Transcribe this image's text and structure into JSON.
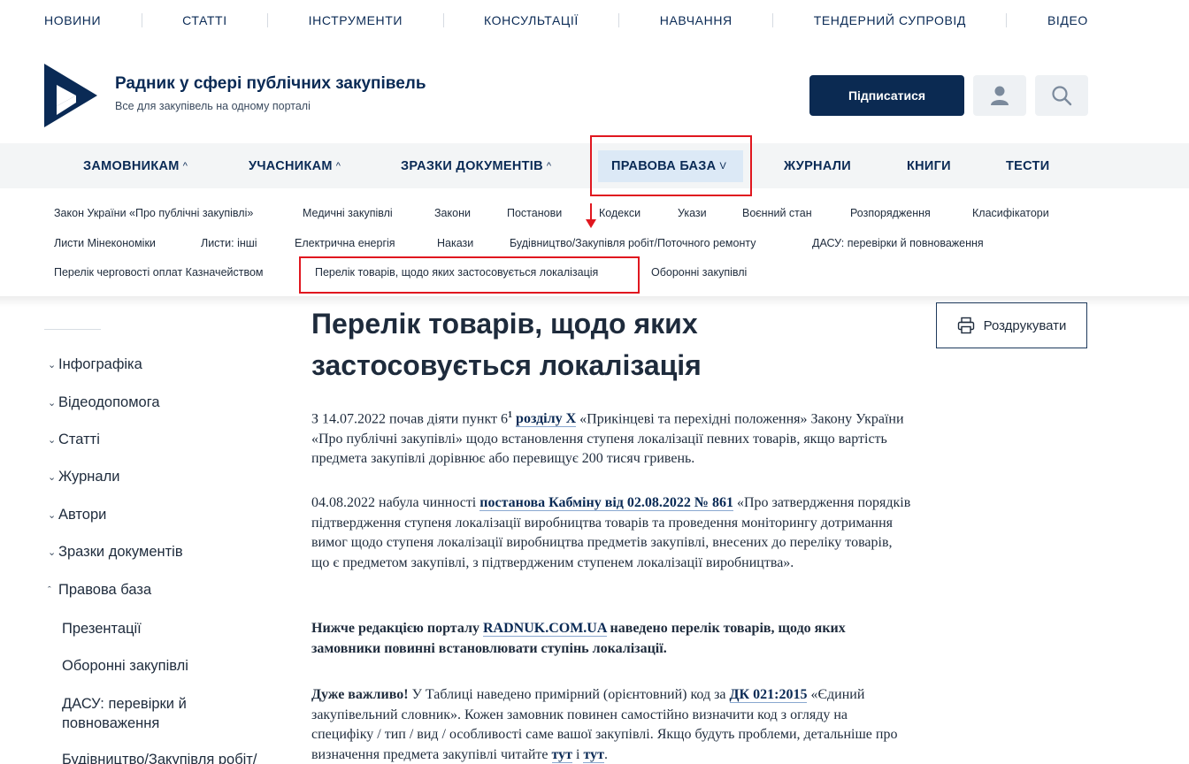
{
  "topnav": [
    "НОВИНИ",
    "СТАТТІ",
    "ІНСТРУМЕНТИ",
    "КОНСУЛЬТАЦІЇ",
    "НАВЧАННЯ",
    "ТЕНДЕРНИЙ СУПРОВІД",
    "ВІДЕО"
  ],
  "brand": {
    "title": "Радник у сфері публічних закупівель",
    "subtitle": "Все для закупівель на одному порталі"
  },
  "header": {
    "subscribe_label": "Підписатися"
  },
  "mainnav": [
    {
      "label": "ЗАМОВНИКАМ",
      "chevron": "^"
    },
    {
      "label": "УЧАСНИКАМ",
      "chevron": "^"
    },
    {
      "label": "ЗРАЗКИ ДОКУМЕНТІВ",
      "chevron": "^"
    },
    {
      "label": "ПРАВОВА БАЗА",
      "chevron": "v"
    },
    {
      "label": "ЖУРНАЛИ",
      "chevron": ""
    },
    {
      "label": "КНИГИ",
      "chevron": ""
    },
    {
      "label": "ТЕСТИ",
      "chevron": ""
    }
  ],
  "submenu": [
    [
      "Закон України «Про публічні закупівлі»",
      "Медичні закупівлі",
      "Закони",
      "Постанови",
      "Кодекси",
      "Укази",
      "Воєнний стан",
      "Розпорядження",
      "Класифікатори"
    ],
    [
      "Листи Мінекономіки",
      "Листи: інші",
      "Електрична енергія",
      "Накази",
      "Будівництво/Закупівля робіт/Поточного ремонту",
      "ДАСУ: перевірки й повноваження"
    ],
    [
      "Перелік черговості оплат Казначейством",
      "Перелік товарів, щодо яких застосовується локалізація",
      "Оборонні закупівлі"
    ]
  ],
  "sidebar": {
    "items": [
      "Інфографіка",
      "Відеодопомога",
      "Статті",
      "Журнали",
      "Автори",
      "Зразки документів",
      "Правова база"
    ],
    "subitems": [
      "Презентації",
      "Оборонні закупівлі",
      "ДАСУ: перевірки й повноваження",
      "Будівництво/Закупівля робіт/"
    ]
  },
  "article": {
    "title": "Перелік товарів, щодо яких застосовується локалізація",
    "print_label": "Роздрукувати",
    "p1": {
      "t1": "З 14.07.2022 почав діяти пункт 6",
      "sup": "1",
      "link": "розділу X",
      "t2": " «Прикінцеві та перехідні положення» Закону України «Про публічні закупівлі» щодо встановлення ступеня локалізації певних товарів, якщо вартість предмета закупівлі дорівнює або перевищує 200 тисяч гривень."
    },
    "p2": {
      "t1": "04.08.2022 набула чинності ",
      "link": "постанова Кабміну від 02.08.2022 № 861",
      "t2": " «Про затвердження порядків підтвердження ступеня локалізації виробництва товарів та проведення моніторингу дотримання вимог щодо ступеня локалізації виробництва предметів закупівлі, внесених до переліку товарів, що є предметом закупівлі, з підтвердженим ступенем локалізації виробництва»."
    },
    "p3": {
      "t1": "Нижче редакцією порталу ",
      "link": "RADNUK.COM.UA",
      "t2": " наведено перелік товарів, щодо яких замовники повинні встановлювати ступінь локалізації."
    },
    "p4": {
      "bold": "Дуже важливо!",
      "t1": " У Таблиці наведено примірний (орієнтовний) код за ",
      "link1": "ДК 021:2015",
      "t2": " «Єдиний закупівельний словник». Кожен замовник повинен самостійно визначити код з огляду на специфіку / тип / вид / особливості саме вашої закупівлі. Якщо будуть проблеми, детальніше про визначення предмета закупівлі читайте ",
      "link2": "тут",
      "t3": " і ",
      "link3": "тут",
      "t4": "."
    }
  },
  "colors": {
    "brand": "#0a2a55",
    "accent_red": "#e0171f",
    "active_bg": "#dce9f6"
  }
}
